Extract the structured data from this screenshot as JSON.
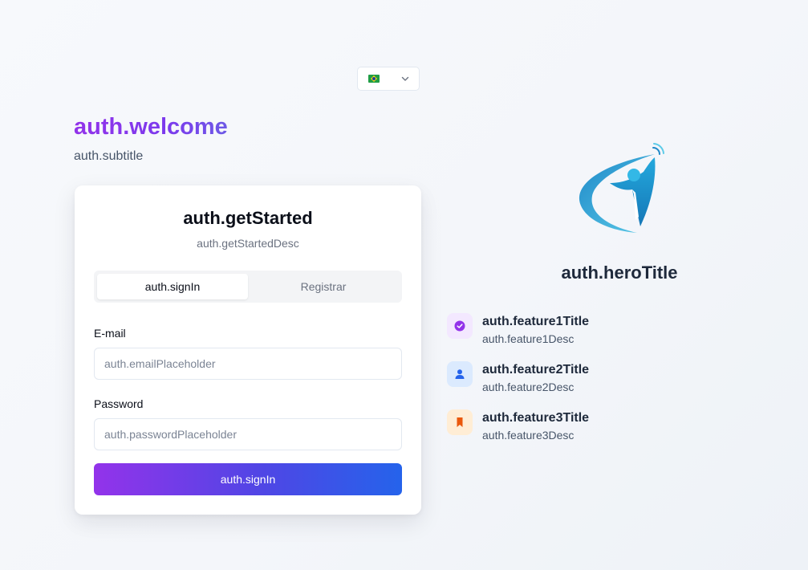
{
  "language": {
    "selected": "pt-BR",
    "flag_icon": "brazil-flag-icon",
    "chevron_icon": "chevron-down-icon"
  },
  "auth": {
    "welcome": "auth.welcome",
    "subtitle": "auth.subtitle",
    "card": {
      "title": "auth.getStarted",
      "description": "auth.getStartedDesc",
      "tabs": [
        {
          "label": "auth.signIn",
          "active": true
        },
        {
          "label": "Registrar",
          "active": false
        }
      ],
      "email": {
        "label": "E-mail",
        "placeholder": "auth.emailPlaceholder",
        "value": ""
      },
      "password": {
        "label": "Password",
        "placeholder": "auth.passwordPlaceholder",
        "value": ""
      },
      "submit_label": "auth.signIn"
    }
  },
  "hero": {
    "logo": "person-swoosh-logo",
    "title": "auth.heroTitle",
    "features": [
      {
        "title": "auth.feature1Title",
        "desc": "auth.feature1Desc",
        "icon": "check-badge-icon",
        "icon_color": "#9333ea",
        "icon_bg": "#f3e8ff"
      },
      {
        "title": "auth.feature2Title",
        "desc": "auth.feature2Desc",
        "icon": "user-icon",
        "icon_color": "#2563eb",
        "icon_bg": "#dbeafe"
      },
      {
        "title": "auth.feature3Title",
        "desc": "auth.feature3Desc",
        "icon": "bookmark-icon",
        "icon_color": "#ea580c",
        "icon_bg": "#ffedd5"
      }
    ]
  },
  "colors": {
    "accent_purple": "#9333ea",
    "accent_blue": "#2563eb"
  }
}
